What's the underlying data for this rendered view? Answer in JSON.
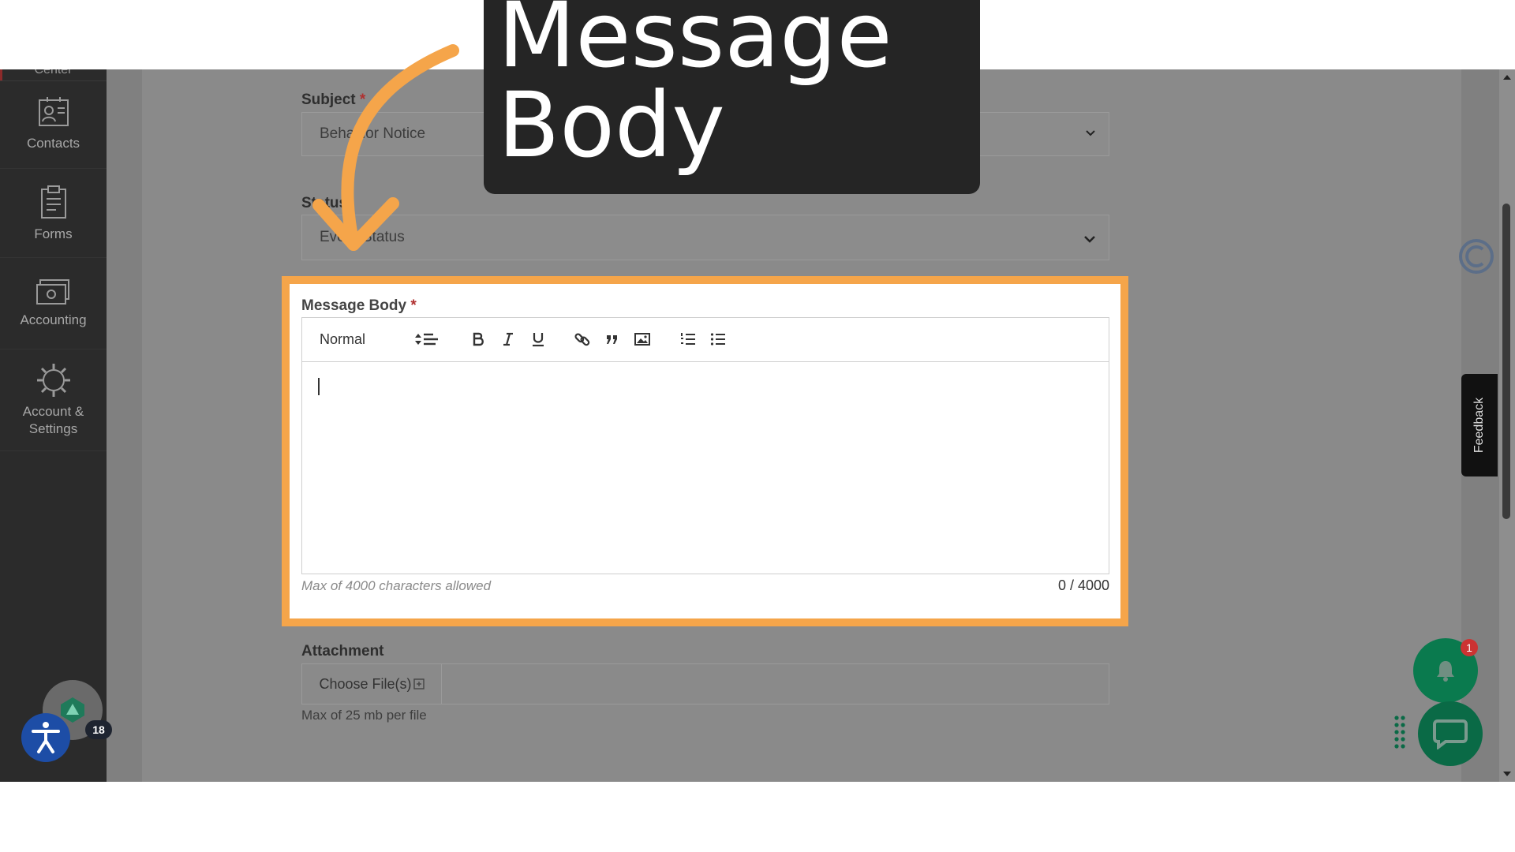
{
  "sidebar": {
    "partial_item": "Center",
    "items": [
      {
        "label": "Contacts",
        "icon": "contacts-icon"
      },
      {
        "label": "Forms",
        "icon": "clipboard-icon"
      },
      {
        "label": "Accounting",
        "icon": "money-icon"
      },
      {
        "label_line1": "Account &",
        "label_line2": "Settings",
        "icon": "gear-icon"
      }
    ],
    "avatar_icon": "logo-avatar-icon",
    "accessibility_icon": "accessibility-icon",
    "badge_count": "18"
  },
  "form": {
    "subject": {
      "label": "Subject",
      "required_mark": "*",
      "value": "Behavior Notice"
    },
    "status": {
      "label": "Status",
      "value": "Event Status"
    },
    "message_body": {
      "label": "Message Body",
      "required_mark": "*",
      "style_select": "Normal",
      "toolbar_icons": [
        "align-icon",
        "bold-icon",
        "italic-icon",
        "underline-icon",
        "link-icon",
        "quote-icon",
        "image-icon",
        "ordered-list-icon",
        "bullet-list-icon"
      ],
      "text": "",
      "hint": "Max of 4000 characters allowed",
      "counter": "0 / 4000"
    },
    "attachment": {
      "label": "Attachment",
      "button": "Choose File(s)",
      "hint": "Max of 25 mb per file"
    }
  },
  "widgets": {
    "feedback_tab": "Feedback",
    "notification_badge": "1"
  },
  "callout": {
    "text": "Message Body"
  },
  "colors": {
    "highlight": "#f5a54a",
    "sidebar_bg": "#2b2b2b",
    "overlay_dim": "#808080",
    "fab_green": "#0a7a4e",
    "callout_bg": "#252525"
  }
}
